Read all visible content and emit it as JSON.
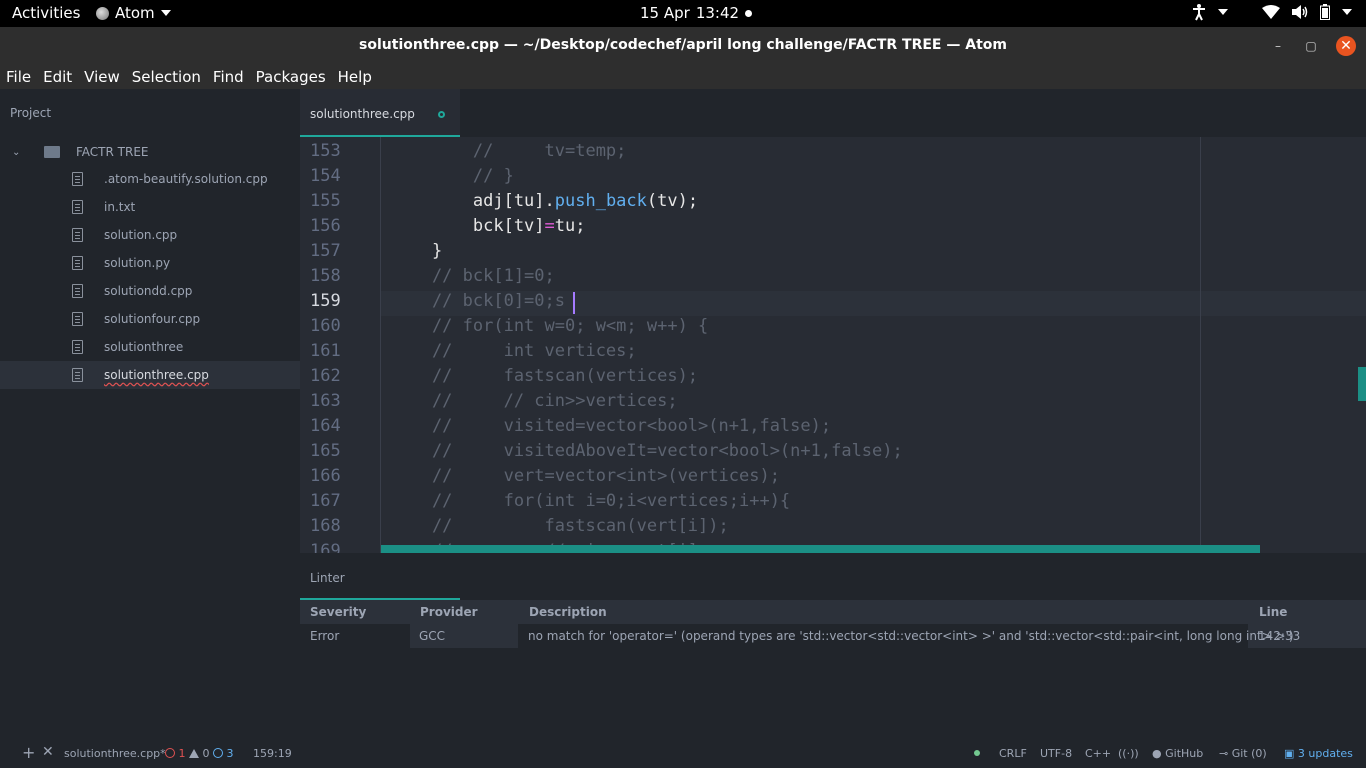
{
  "topbar": {
    "activities": "Activities",
    "app_name": "Atom",
    "date": "15 Apr",
    "time": "13:42"
  },
  "window": {
    "title": "solutionthree.cpp — ~/Desktop/codechef/april long challenge/FACTR TREE — Atom",
    "minimize": "–",
    "maximize": "▢",
    "close": "✕"
  },
  "menu": [
    "File",
    "Edit",
    "View",
    "Selection",
    "Find",
    "Packages",
    "Help"
  ],
  "tree": {
    "header": "Project",
    "root": "FACTR TREE",
    "files": [
      ".atom-beautify.solution.cpp",
      "in.txt",
      "solution.cpp",
      "solution.py",
      "solutiondd.cpp",
      "solutionfour.cpp",
      "solutionthree",
      "solutionthree.cpp"
    ],
    "selected": "solutionthree.cpp"
  },
  "tab": {
    "label": "solutionthree.cpp"
  },
  "editor": {
    "current_line": 159,
    "lines": [
      {
        "n": "153",
        "tokens": [
          [
            "cm",
            "        //     tv=temp;"
          ]
        ]
      },
      {
        "n": "154",
        "tokens": [
          [
            "cm",
            "        // }"
          ]
        ]
      },
      {
        "n": "155",
        "tokens": [
          [
            "tx",
            "        adj[tu]."
          ],
          [
            "fn",
            "push_back"
          ],
          [
            "tx",
            "(tv);"
          ]
        ]
      },
      {
        "n": "156",
        "tokens": [
          [
            "tx",
            "        bck[tv]"
          ],
          [
            "op",
            "="
          ],
          [
            "tx",
            "tu;"
          ]
        ]
      },
      {
        "n": "157",
        "tokens": [
          [
            "tx",
            "    }"
          ]
        ]
      },
      {
        "n": "158",
        "tokens": [
          [
            "cm",
            "    // bck[1]=0;"
          ]
        ]
      },
      {
        "n": "159",
        "tokens": [
          [
            "cm",
            "    // bck[0]=0;s "
          ]
        ]
      },
      {
        "n": "160",
        "tokens": [
          [
            "cm",
            "    // for(int w=0; w<m; w++) {"
          ]
        ]
      },
      {
        "n": "161",
        "tokens": [
          [
            "cm",
            "    //     int vertices;"
          ]
        ]
      },
      {
        "n": "162",
        "tokens": [
          [
            "cm",
            "    //     fastscan(vertices);"
          ]
        ]
      },
      {
        "n": "163",
        "tokens": [
          [
            "cm",
            "    //     // cin>>vertices;"
          ]
        ]
      },
      {
        "n": "164",
        "tokens": [
          [
            "cm",
            "    //     visited=vector<bool>(n+1,false);"
          ]
        ]
      },
      {
        "n": "165",
        "tokens": [
          [
            "cm",
            "    //     visitedAboveIt=vector<bool>(n+1,false);"
          ]
        ]
      },
      {
        "n": "166",
        "tokens": [
          [
            "cm",
            "    //     vert=vector<int>(vertices);"
          ]
        ]
      },
      {
        "n": "167",
        "tokens": [
          [
            "cm",
            "    //     for(int i=0;i<vertices;i++){"
          ]
        ]
      },
      {
        "n": "168",
        "tokens": [
          [
            "cm",
            "    //         fastscan(vert[i]);"
          ]
        ]
      },
      {
        "n": "169",
        "tokens": [
          [
            "cm",
            "    //         // cin>>vert[i];"
          ]
        ]
      }
    ]
  },
  "linter": {
    "tab": "Linter",
    "headers": {
      "severity": "Severity",
      "provider": "Provider",
      "description": "Description",
      "line": "Line"
    },
    "rows": [
      {
        "severity": "Error",
        "provider": "GCC",
        "description": "no match for 'operator=' (operand types are 'std::vector<std::vector<int> >' and 'std::vector<std::pair<int, long long int> >')",
        "line": "142:33"
      }
    ]
  },
  "status": {
    "file": "solutionthree.cpp*",
    "errors": "1",
    "warnings": "0",
    "infos": "3",
    "cursor": "159:19",
    "line_ending": "CRLF",
    "encoding": "UTF-8",
    "grammar": "C++",
    "github": "GitHub",
    "git": "Git (0)",
    "updates": "3 updates"
  },
  "colors": {
    "accent": "#1fa89b",
    "error": "#e05252",
    "info": "#61afef",
    "ok": "#73c990"
  }
}
